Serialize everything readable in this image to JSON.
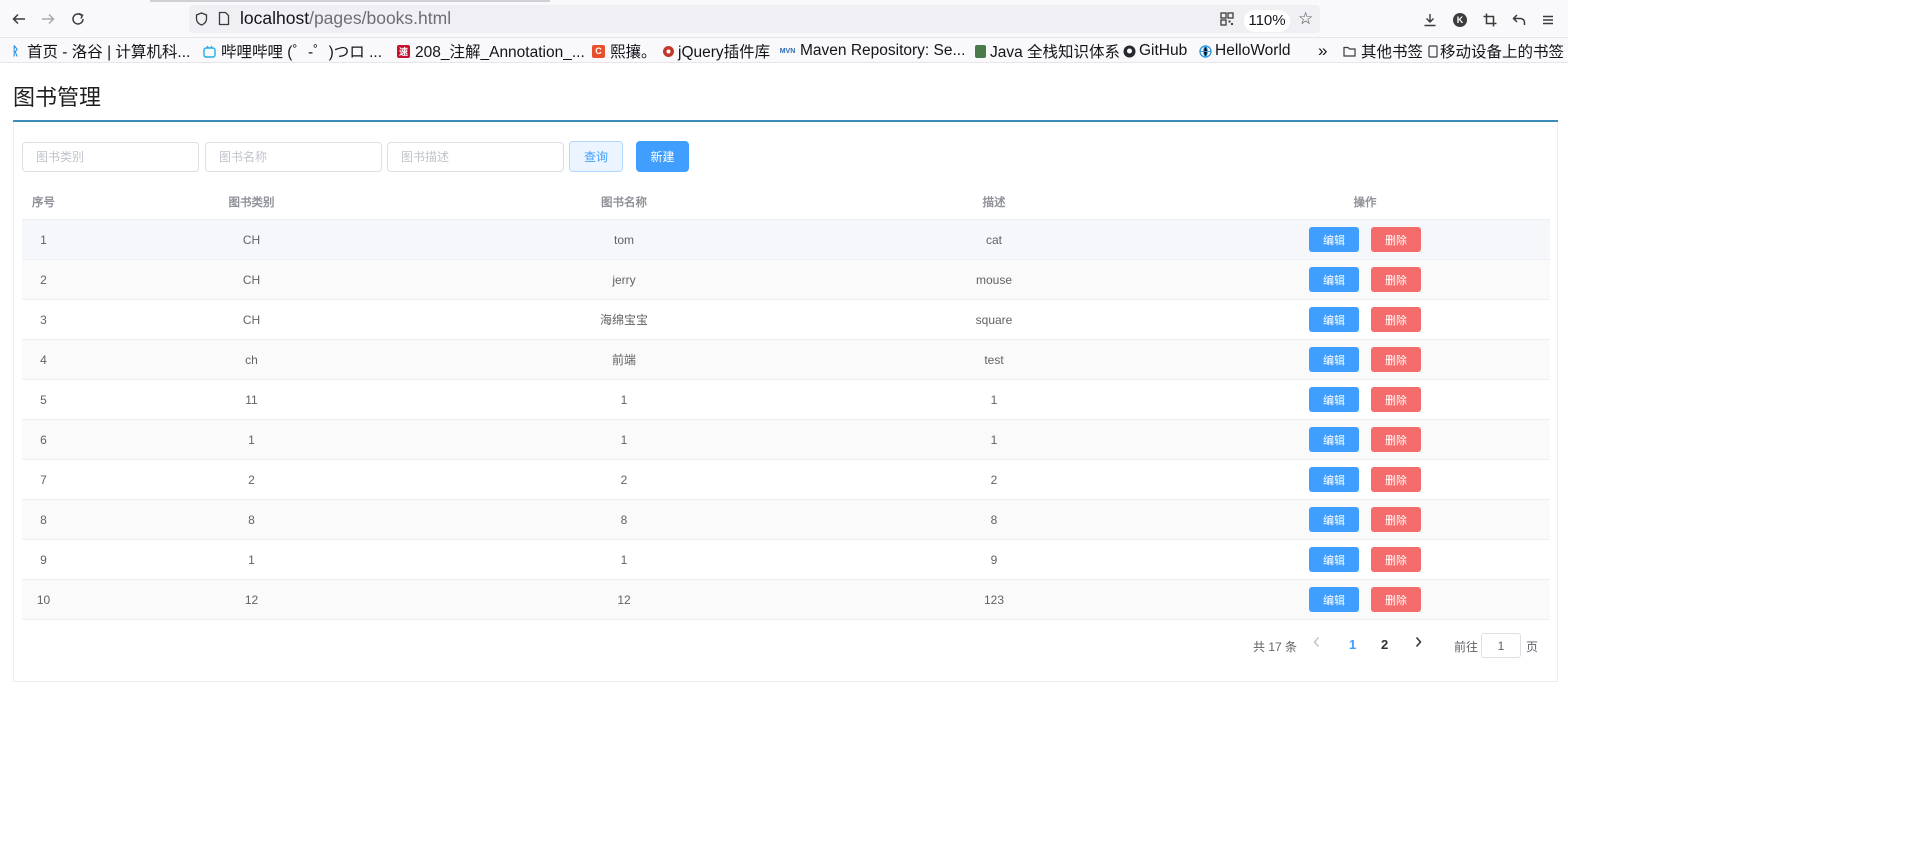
{
  "browser": {
    "url_host": "localhost",
    "url_path": "/pages/books.html",
    "zoom": "110%"
  },
  "bookmarks": [
    {
      "label": "首页 - 洛谷 | 计算机科...",
      "icon": "luogu-icon",
      "color": "#1e88e5"
    },
    {
      "label": "哔哩哔哩 (゜-゜)つロ ...",
      "icon": "bilibili-icon",
      "color": "#23ade5"
    },
    {
      "label": "208_注解_Annotation_...",
      "icon": "red-square-icon",
      "color": "#c8102e"
    },
    {
      "label": "熙攘。",
      "icon": "c-icon",
      "color": "#e8502d"
    },
    {
      "label": "jQuery插件库",
      "icon": "jquery-icon",
      "color": "#c0392b"
    },
    {
      "label": "Maven Repository: Se...",
      "icon": "mvn-icon",
      "color": "#2a6ab2"
    },
    {
      "label": "Java 全栈知识体系",
      "icon": "java-icon",
      "color": "#4a7a4a"
    },
    {
      "label": "GitHub",
      "icon": "github-icon",
      "color": "#24292e"
    },
    {
      "label": "HelloWorld",
      "icon": "helloworld-icon",
      "color": "#3a9ad9"
    }
  ],
  "bookmarks_right": {
    "more": "»",
    "other": "其他书签",
    "mobile": "移动设备上的书签"
  },
  "page": {
    "title": "图书管理"
  },
  "search": {
    "category_placeholder": "图书类别",
    "name_placeholder": "图书名称",
    "desc_placeholder": "图书描述",
    "query_label": "查询",
    "new_label": "新建"
  },
  "table": {
    "headers": [
      "序号",
      "图书类别",
      "图书名称",
      "描述",
      "操作"
    ],
    "edit_label": "编辑",
    "delete_label": "删除",
    "rows": [
      {
        "index": "1",
        "category": "CH",
        "name": "tom",
        "desc": "cat"
      },
      {
        "index": "2",
        "category": "CH",
        "name": "jerry",
        "desc": "mouse"
      },
      {
        "index": "3",
        "category": "CH",
        "name": "海绵宝宝",
        "desc": "square"
      },
      {
        "index": "4",
        "category": "ch",
        "name": "前端",
        "desc": "test"
      },
      {
        "index": "5",
        "category": "11",
        "name": "1",
        "desc": "1"
      },
      {
        "index": "6",
        "category": "1",
        "name": "1",
        "desc": "1"
      },
      {
        "index": "7",
        "category": "2",
        "name": "2",
        "desc": "2"
      },
      {
        "index": "8",
        "category": "8",
        "name": "8",
        "desc": "8"
      },
      {
        "index": "9",
        "category": "1",
        "name": "1",
        "desc": "9"
      },
      {
        "index": "10",
        "category": "12",
        "name": "12",
        "desc": "123"
      }
    ]
  },
  "pagination": {
    "total_text": "共 17 条",
    "pages": [
      "1",
      "2"
    ],
    "current": "1",
    "goto_label": "前往",
    "goto_value": "1",
    "page_suffix": "页"
  },
  "colors": {
    "primary": "#409eff",
    "danger": "#f56c6c",
    "title_line": "#3c8dbc"
  }
}
